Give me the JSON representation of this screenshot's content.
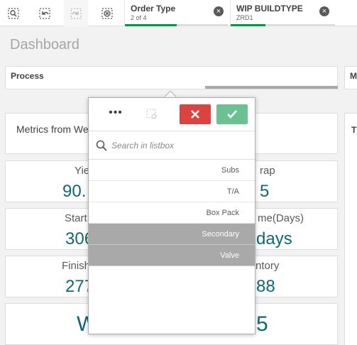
{
  "toolbar": {
    "buttons": [
      {
        "name": "smart-search-button",
        "icon": "zoom-selection-icon"
      },
      {
        "name": "step-back-button",
        "icon": "step-back-icon"
      },
      {
        "name": "step-forward-button",
        "icon": "step-forward-icon"
      },
      {
        "name": "clear-all-button",
        "icon": "clear-selections-icon"
      }
    ]
  },
  "selections": [
    {
      "title": "Order Type",
      "subtitle": "2 of 4",
      "fill": 0.5
    },
    {
      "title": "WIP BUILDTYPE",
      "subtitle": "ZRD1",
      "fill": 0.33
    }
  ],
  "sheet": {
    "title": "Dashboard"
  },
  "filters": {
    "process_label": "Process",
    "second_label_fragment": "M"
  },
  "metrics_panel": {
    "text_fragment": "Metrics from We"
  },
  "right_panel": {
    "label_fragment": "T"
  },
  "kpis": [
    {
      "label": "Yie",
      "value": "90.",
      "right_label": "rap",
      "right_value": "5"
    },
    {
      "label": "Start",
      "value": "306",
      "right_label": "me(Days)",
      "right_value": "days"
    },
    {
      "label": "Finish",
      "value": "277",
      "right_label": "ntory",
      "right_value": "88"
    }
  ],
  "bottom_kpi": {
    "left_value": "W",
    "right_value": "5"
  },
  "listbox": {
    "more_label": "•••",
    "search_placeholder": "Search in listbox",
    "items": [
      {
        "label": "Subs",
        "state": "possible"
      },
      {
        "label": "T/A",
        "state": "possible"
      },
      {
        "label": "Box Pack",
        "state": "possible"
      },
      {
        "label": "Secondary",
        "state": "alternative"
      },
      {
        "label": "Valve",
        "state": "alternative"
      }
    ]
  },
  "colors": {
    "selected_green": "#009845",
    "cancel_red": "#dc423f",
    "confirm_green": "#6cc193",
    "alternative_grey": "#a9a9a9",
    "kpi_teal": "#0e6875"
  }
}
